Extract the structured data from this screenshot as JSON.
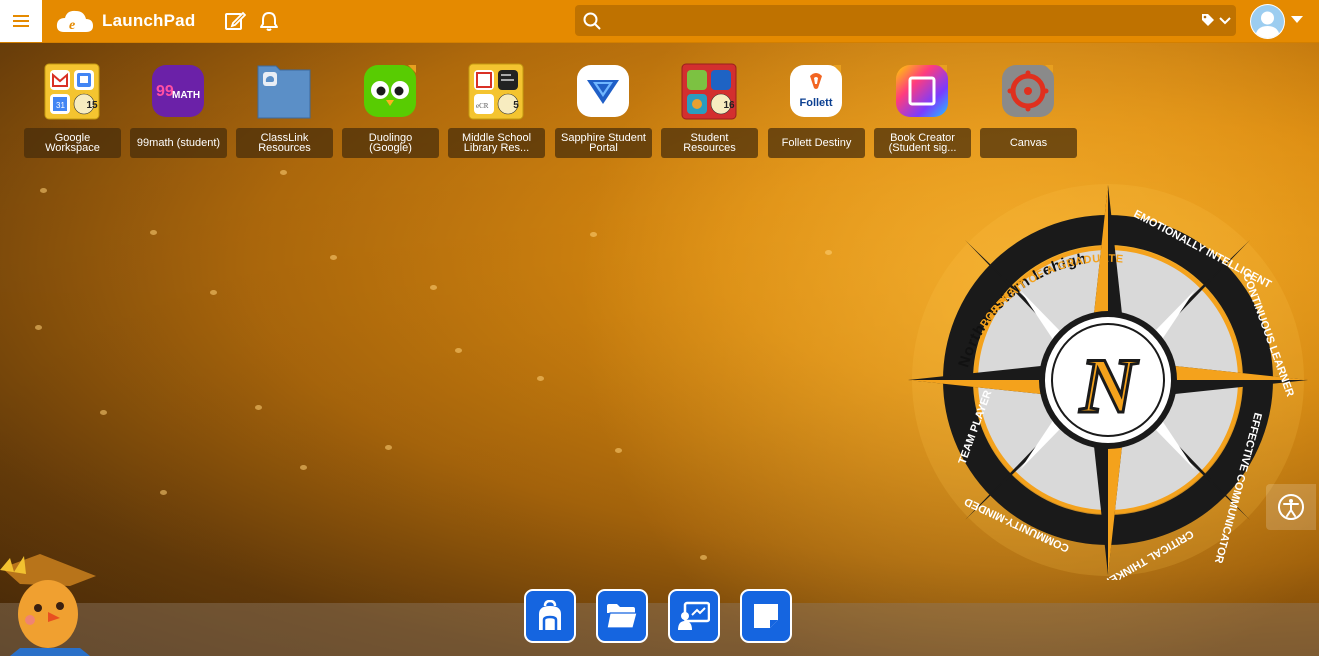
{
  "header": {
    "brand": "LaunchPad",
    "search_placeholder": ""
  },
  "apps": [
    {
      "label": "Google Workspace",
      "icon": "google-workspace-folder-icon",
      "badge": "15"
    },
    {
      "label": "99math (student)",
      "icon": "99math-icon"
    },
    {
      "label": "ClassLink Resources",
      "icon": "classlink-resources-folder-icon"
    },
    {
      "label": "Duolingo (Google)",
      "icon": "duolingo-owl-icon"
    },
    {
      "label": "Middle School Library Res...",
      "icon": "library-resources-folder-icon",
      "badge": "5"
    },
    {
      "label": "Sapphire Student Portal",
      "icon": "sapphire-icon"
    },
    {
      "label": "Student Resources",
      "icon": "student-resources-folder-icon",
      "badge": "16"
    },
    {
      "label": "Follett Destiny",
      "icon": "follett-icon",
      "icon_text": "Follett"
    },
    {
      "label": "Book Creator (Student sig...",
      "icon": "book-creator-icon"
    },
    {
      "label": "Canvas",
      "icon": "canvas-icon"
    }
  ],
  "emblem": {
    "title": "Northwestern Lehigh",
    "subtitle": "PORTRAIT OF A GRADUATE",
    "traits": [
      "EMOTIONALLY INTELLIGENT",
      "CONTINUOUS LEARNER",
      "EFFECTIVE COMMUNICATOR",
      "CRITICAL THINKER",
      "COMMUNITY-MINDED",
      "TEAM PLAYER"
    ],
    "letter": "N"
  },
  "dock": [
    "backpack-icon",
    "folder-icon",
    "classroom-icon",
    "note-icon"
  ],
  "colors": {
    "topbar": "#e58a00",
    "dock_button": "#1565e0"
  }
}
